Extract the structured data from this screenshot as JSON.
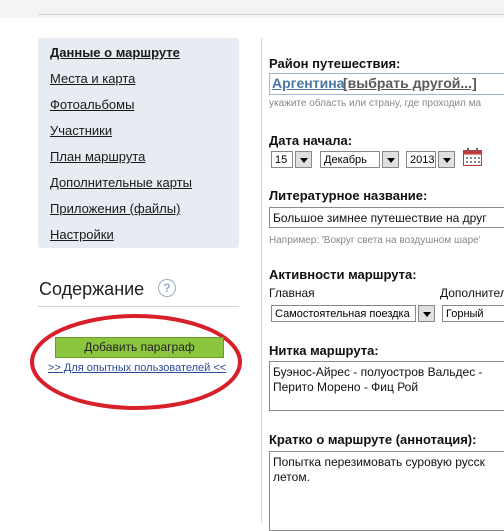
{
  "sidebar": {
    "items": [
      {
        "label": "Данные о маршруте",
        "active": true
      },
      {
        "label": "Места и карта"
      },
      {
        "label": "Фотоальбомы"
      },
      {
        "label": "Участники"
      },
      {
        "label": "План маршрута"
      },
      {
        "label": "Дополнительные карты"
      },
      {
        "label": "Приложения (файлы)"
      },
      {
        "label": "Настройки"
      }
    ]
  },
  "contents": {
    "title": "Содержание",
    "help": "?",
    "add_button": "Добавить параграф",
    "expert_link": ">> Для опытных пользователей <<"
  },
  "form": {
    "region": {
      "label": "Район путешествия:",
      "country": "Аргентина",
      "choose_other": "[выбрать другой...]",
      "hint": "укажите область или страну, где проходил ма"
    },
    "start_date": {
      "label": "Дата начала:",
      "day": "15",
      "month": "Декабрь",
      "year": "2013"
    },
    "literary_name": {
      "label": "Литературное название:",
      "value": "Большое зимнее путешествие на друг",
      "hint": "Например: 'Вокруг света на воздушном шаре'"
    },
    "activities": {
      "label": "Активности маршрута:",
      "main_label": "Главная",
      "extra_label": "Дополнител",
      "main_value": "Самостоятельная поездка",
      "extra_value": "Горный"
    },
    "route_thread": {
      "label": "Нитка маршрута:",
      "line1": "Буэнос-Айрес - полуостров Вальдес -",
      "line2": "Перито Морено - Фиц Рой"
    },
    "summary": {
      "label": "Кратко о маршруте (аннотация):",
      "line1": "Попытка перезимовать суровую русск",
      "line2": "летом."
    }
  },
  "colors": {
    "sidebar_bg": "#e6ecf2",
    "add_button_bg": "#8cc63f",
    "annotation_oval": "#d8202a",
    "country_link": "#4a78a4"
  }
}
